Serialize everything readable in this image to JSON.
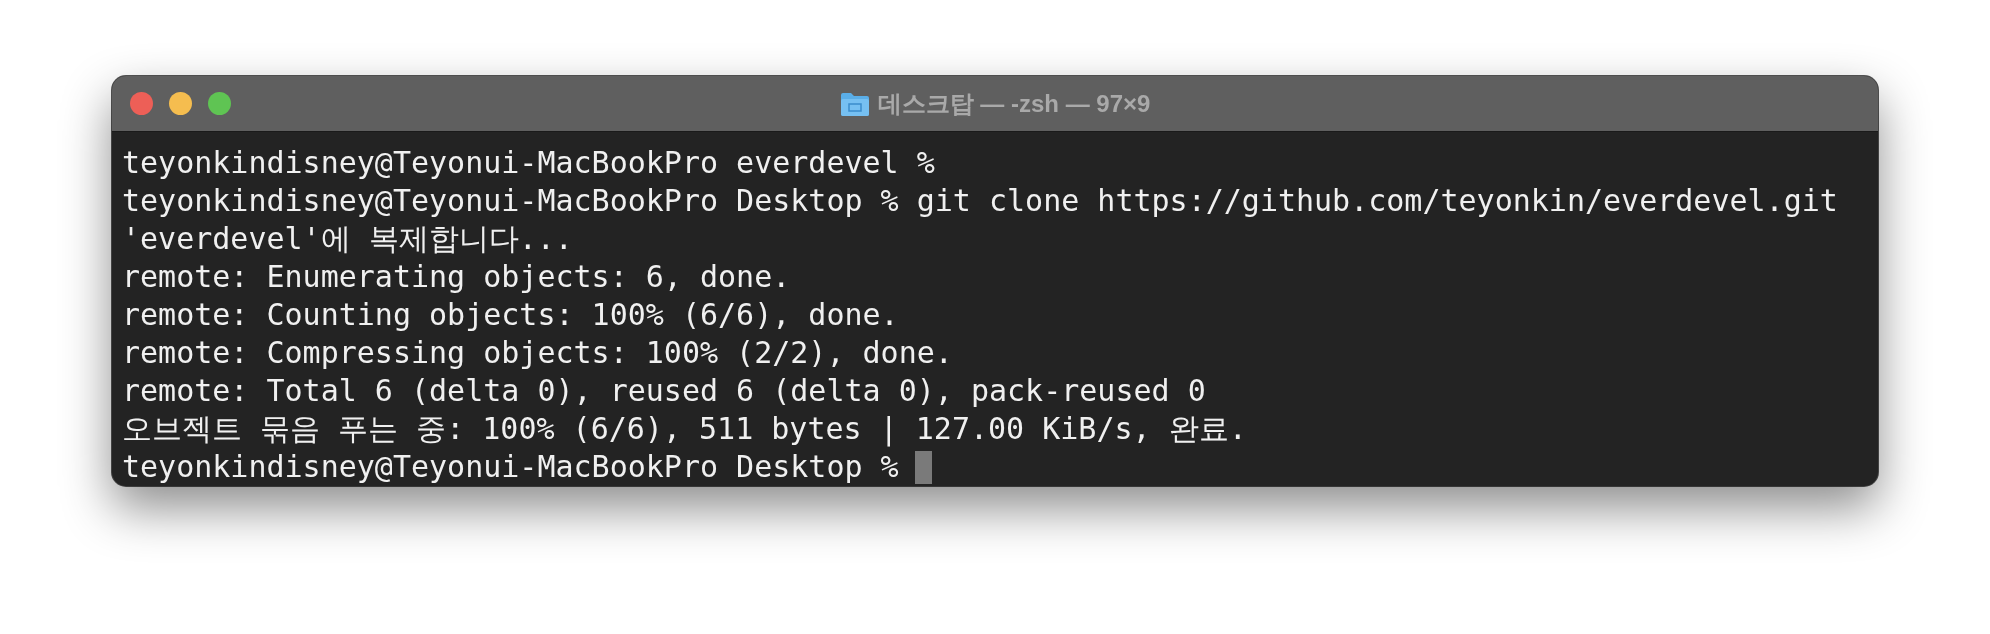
{
  "window": {
    "title": "데스크탑 — -zsh — 97×9"
  },
  "lines": [
    {
      "text": "teyonkindisney@Teyonui-MacBookPro everdevel %",
      "cursor": false
    },
    {
      "text": "teyonkindisney@Teyonui-MacBookPro Desktop % git clone https://github.com/teyonkin/everdevel.git",
      "cursor": false
    },
    {
      "text": "'everdevel'에 복제합니다...",
      "cursor": false
    },
    {
      "text": "remote: Enumerating objects: 6, done.",
      "cursor": false
    },
    {
      "text": "remote: Counting objects: 100% (6/6), done.",
      "cursor": false
    },
    {
      "text": "remote: Compressing objects: 100% (2/2), done.",
      "cursor": false
    },
    {
      "text": "remote: Total 6 (delta 0), reused 6 (delta 0), pack-reused 0",
      "cursor": false
    },
    {
      "text": "오브젝트 묶음 푸는 중: 100% (6/6), 511 bytes | 127.00 KiB/s, 완료.",
      "cursor": false
    },
    {
      "text": "teyonkindisney@Teyonui-MacBookPro Desktop %",
      "cursor": true
    }
  ]
}
